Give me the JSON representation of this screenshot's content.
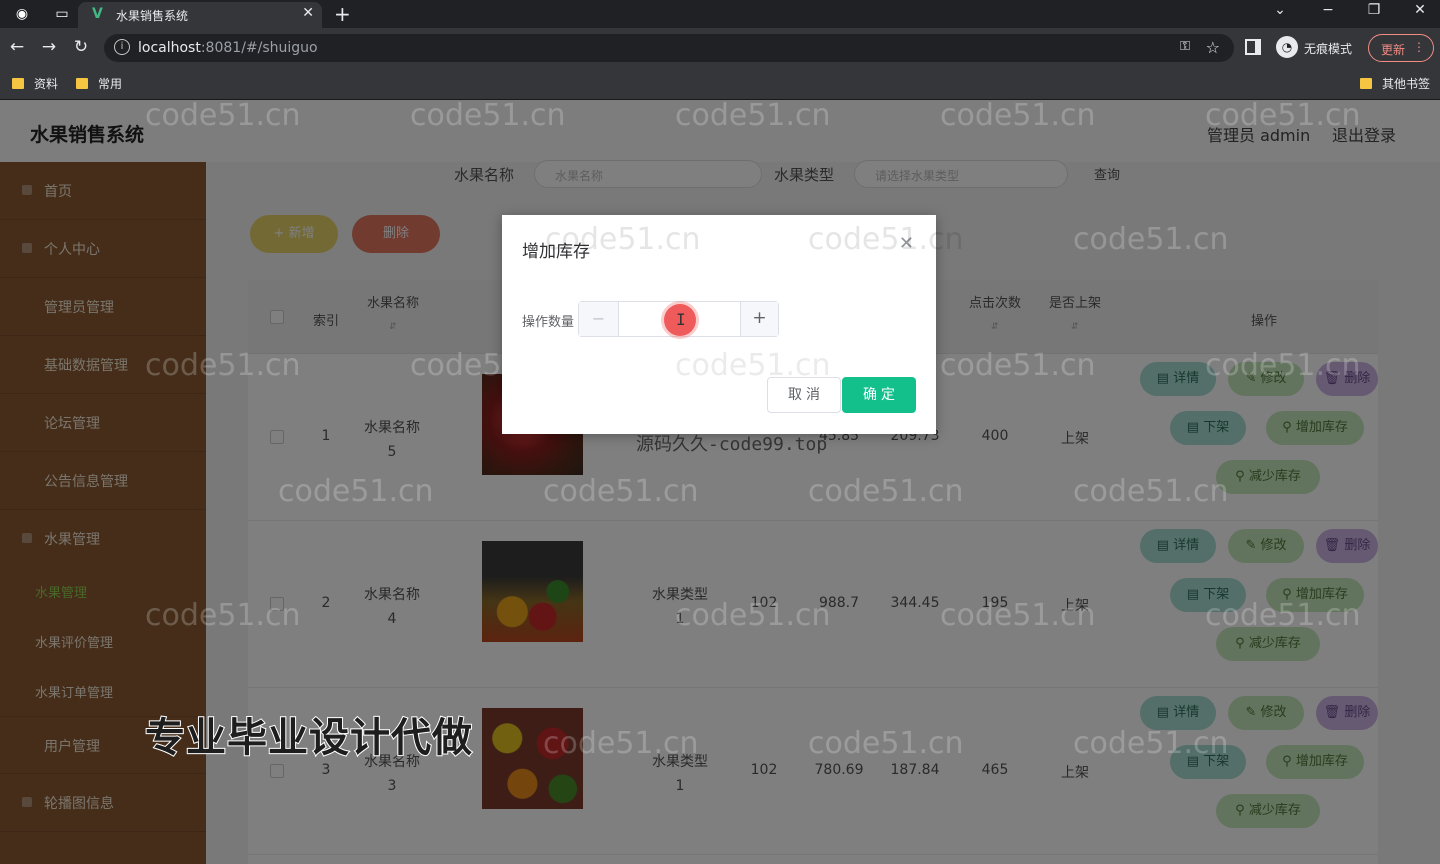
{
  "browser": {
    "tab_title": "水果销售系统",
    "url_host": "localhost",
    "url_rest": ":8081/#/shuiguo",
    "incognito_label": "无痕模式",
    "update_label": "更新",
    "bookmarks": [
      "资料",
      "常用"
    ],
    "other_bookmarks": "其他书签"
  },
  "header": {
    "title": "水果销售系统",
    "admin": "管理员 admin",
    "logout": "退出登录"
  },
  "sidebar": {
    "items": [
      {
        "label": "首页"
      },
      {
        "label": "个人中心"
      },
      {
        "label": "管理员管理"
      },
      {
        "label": "基础数据管理"
      },
      {
        "label": "论坛管理"
      },
      {
        "label": "公告信息管理"
      },
      {
        "label": "水果管理"
      }
    ],
    "subitems": [
      {
        "label": "水果管理",
        "active": true
      },
      {
        "label": "水果评价管理"
      },
      {
        "label": "水果订单管理"
      }
    ],
    "items_after": [
      {
        "label": "用户管理"
      },
      {
        "label": "轮播图信息"
      }
    ]
  },
  "search": {
    "name_label": "水果名称",
    "name_placeholder": "水果名称",
    "type_label": "水果类型",
    "type_placeholder": "请选择水果类型",
    "query_label": "查询"
  },
  "actions": {
    "add": "+ 新增",
    "delete": "删除"
  },
  "table": {
    "headers": {
      "index": "索引",
      "name": "水果名称",
      "clicks": "点击次数",
      "on_shelf": "是否上架",
      "ops": "操作"
    },
    "rows": [
      {
        "index": "1",
        "name": "水果名称\n5",
        "type": "",
        "stock": "",
        "price1": "45.85",
        "price2": "209.73",
        "clicks": "400",
        "shelf": "上架"
      },
      {
        "index": "2",
        "name": "水果名称\n4",
        "type": "水果类型\n1",
        "stock": "102",
        "price1": "988.7",
        "price2": "344.45",
        "clicks": "195",
        "shelf": "上架"
      },
      {
        "index": "3",
        "name": "水果名称\n3",
        "type": "水果类型\n1",
        "stock": "102",
        "price1": "780.69",
        "price2": "187.84",
        "clicks": "465",
        "shelf": "上架"
      }
    ],
    "op_labels": {
      "detail": "详情",
      "edit": "修改",
      "delete": "删除",
      "off_shelf": "下架",
      "add_stock": "增加库存",
      "reduce_stock": "减少库存"
    }
  },
  "dialog": {
    "title": "增加库存",
    "field_label": "操作数量",
    "value": "",
    "cancel": "取消",
    "confirm": "确定"
  },
  "watermark": {
    "text": "code51.cn",
    "promo": "专业毕业设计代做",
    "promo2": "源码久久-code99.top"
  },
  "colors": {
    "sidebar": "#8b5a33",
    "confirm": "#13c08c",
    "active_sub": "#8fd14f"
  }
}
